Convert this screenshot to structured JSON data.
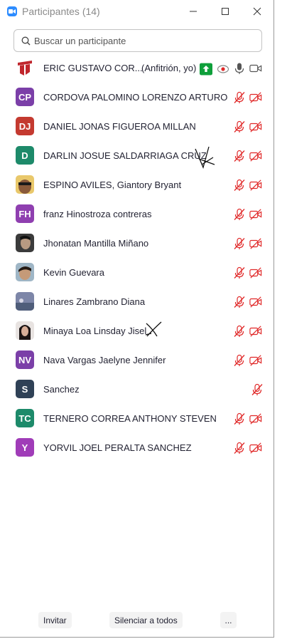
{
  "window": {
    "title": "Participantes (14)"
  },
  "search": {
    "placeholder": "Buscar un participante"
  },
  "host": {
    "name": "ERIC GUSTAVO COR...",
    "role": "(Anfitrión, yo)"
  },
  "participants": [
    {
      "initials": "CP",
      "name": "CORDOVA PALOMINO LORENZO ARTURO",
      "color": "#7b3fa8"
    },
    {
      "initials": "DJ",
      "name": "DANIEL JONAS FIGUEROA MILLAN",
      "color": "#c43a30"
    },
    {
      "initials": "D",
      "name": "DARLIN JOSUE SALDARRIAGA CRUZ",
      "color": "#1d8a6a"
    },
    {
      "initials": "",
      "name": "ESPINO AVILES, Giantory Bryant"
    },
    {
      "initials": "FH",
      "name": "franz Hinostroza contreras",
      "color": "#8f3fb0"
    },
    {
      "initials": "",
      "name": "Jhonatan Mantilla Miñano"
    },
    {
      "initials": "",
      "name": "Kevin Guevara"
    },
    {
      "initials": "",
      "name": "Linares Zambrano Diana"
    },
    {
      "initials": "",
      "name": "Minaya Loa Linsday Jisel"
    },
    {
      "initials": "NV",
      "name": "Nava Vargas Jaelyne Jennifer",
      "color": "#7b3fa8"
    },
    {
      "initials": "S",
      "name": "Sanchez",
      "color": "#2f4156"
    },
    {
      "initials": "TC",
      "name": "TERNERO CORREA ANTHONY STEVEN",
      "color": "#1d8a6a"
    },
    {
      "initials": "Y",
      "name": "YORVIL JOEL PERALTA SANCHEZ",
      "color": "#a03cb8"
    }
  ],
  "footer": {
    "invite": "Invitar",
    "mute_all": "Silenciar a todos",
    "more": "..."
  },
  "colors": {
    "muted": "#e02828",
    "accent": "#2d8cff",
    "share": "#0e9f3a"
  }
}
